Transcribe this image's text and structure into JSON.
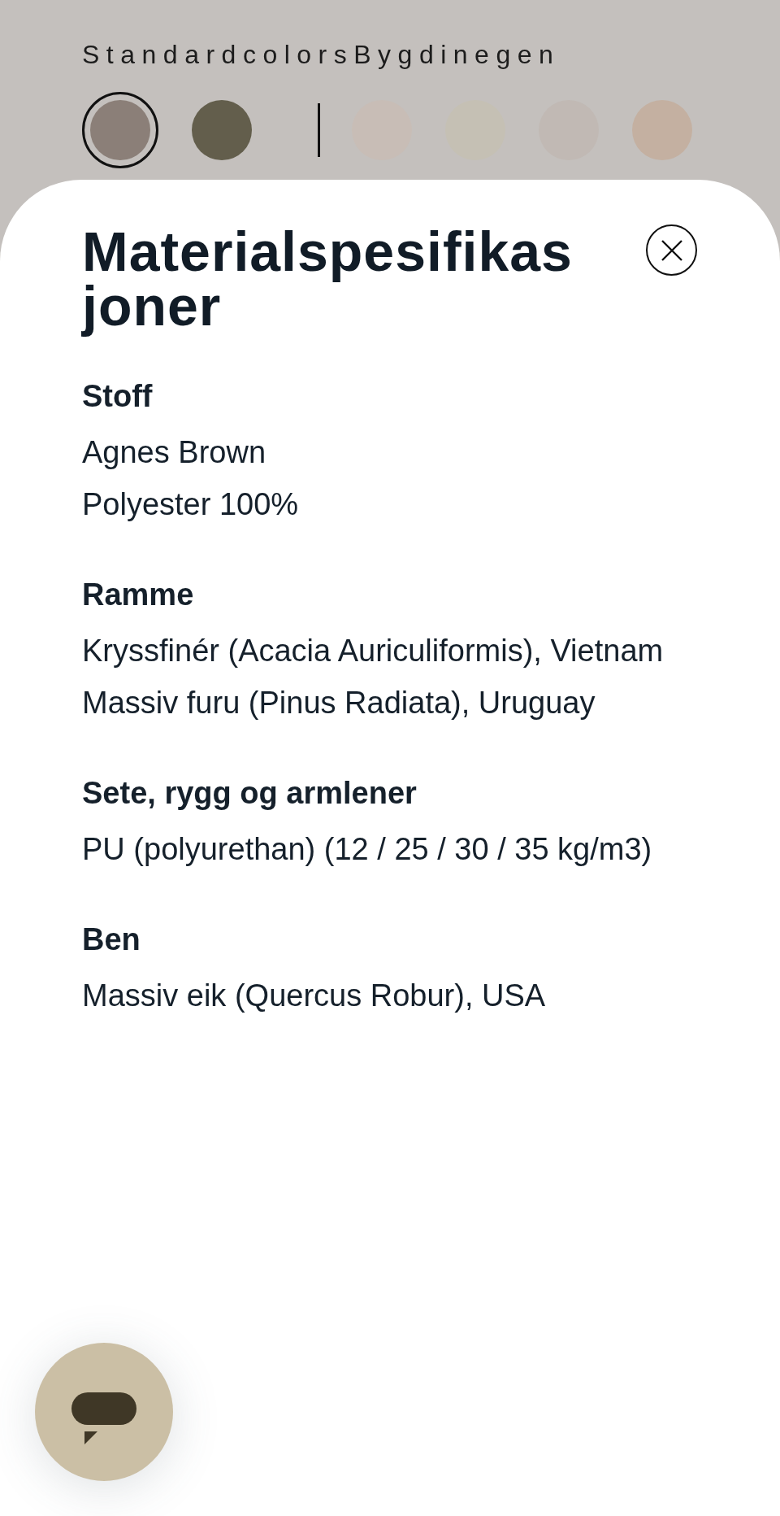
{
  "color_picker": {
    "labels": [
      "Standardcolors",
      "Bygdinegen"
    ],
    "swatch_groups": [
      {
        "swatches": [
          {
            "color": "#8b7f78",
            "selected": true
          },
          {
            "color": "#635e4c",
            "selected": false
          }
        ]
      },
      {
        "swatches": [
          {
            "color": "#c8bdb6",
            "selected": false
          },
          {
            "color": "#c5c0b4",
            "selected": false
          },
          {
            "color": "#c1b9b4",
            "selected": false
          },
          {
            "color": "#c4b0a1",
            "selected": false
          }
        ]
      }
    ]
  },
  "panel": {
    "title": "Materialspesifikasjoner",
    "sections": [
      {
        "heading": "Stoff",
        "lines": [
          "Agnes Brown",
          "Polyester 100%"
        ]
      },
      {
        "heading": "Ramme",
        "lines": [
          "Kryssfinér (Acacia Auriculiformis), Vietnam",
          "Massiv furu (Pinus Radiata), Uruguay"
        ]
      },
      {
        "heading": "Sete, rygg og armlener",
        "lines": [
          "PU (polyurethan) (12 / 25 / 30 / 35 kg/m3)"
        ]
      },
      {
        "heading": "Ben",
        "lines": [
          "Massiv eik (Quercus Robur), USA"
        ]
      }
    ]
  }
}
